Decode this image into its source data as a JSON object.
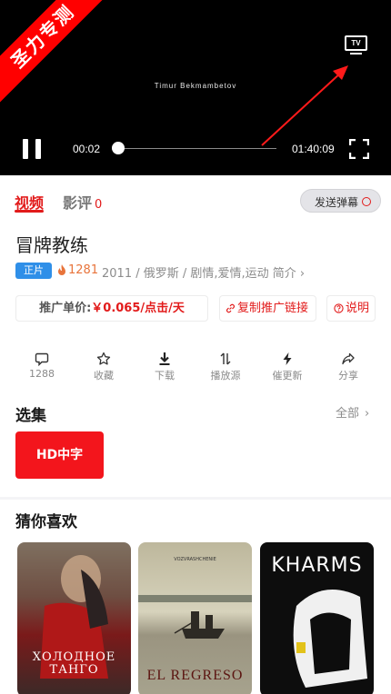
{
  "player": {
    "caption": "Timur Bekmambetov",
    "banner": "圣力专测",
    "tv_label": "TV",
    "current_time": "00:02",
    "total_time": "01:40:09",
    "progress": 0.002
  },
  "tabs": {
    "video": "视频",
    "review": "影评",
    "review_count": "0",
    "danmaku": "发送弹幕"
  },
  "movie": {
    "title": "冒牌教练",
    "badge": "正片",
    "heat": "1281",
    "meta": "2011 / 俄罗斯 / 剧情,爱情,运动  简介 ›"
  },
  "promo": {
    "price_label": "推广单价:",
    "price_value": "￥0.065/点击/天",
    "copy_link": "复制推广链接",
    "explain": "说明"
  },
  "actions": [
    {
      "label": "1288",
      "icon": "comment-icon"
    },
    {
      "label": "收藏",
      "icon": "star-icon"
    },
    {
      "label": "下载",
      "icon": "download-icon"
    },
    {
      "label": "播放源",
      "icon": "switch-source-icon"
    },
    {
      "label": "催更新",
      "icon": "lightning-icon"
    },
    {
      "label": "分享",
      "icon": "share-icon"
    }
  ],
  "episodes": {
    "title": "选集",
    "all_label": "全部",
    "items": [
      "HD中字"
    ]
  },
  "recommend": {
    "title": "猜你喜欢",
    "posters": [
      {
        "text": "ХОЛОДНОЕ ТАНГО"
      },
      {
        "text": "EL REGRESO",
        "top": "VOZVRASHCHENIE"
      },
      {
        "text": "KHARMS"
      }
    ]
  },
  "colors": {
    "accent": "#e21b1b",
    "badge_blue": "#2f8fe8",
    "heat_orange": "#e8743b"
  }
}
